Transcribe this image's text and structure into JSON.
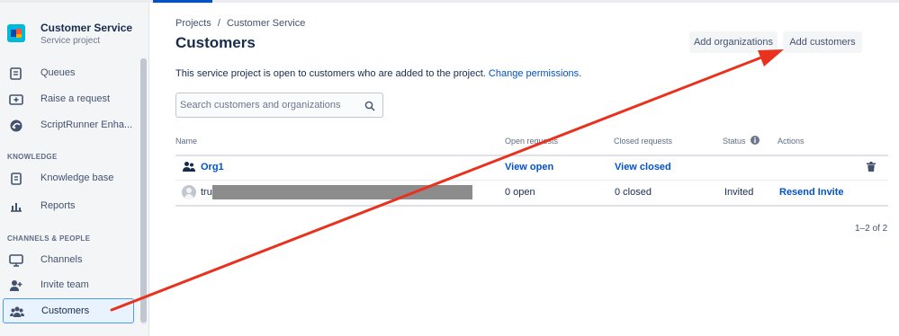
{
  "project": {
    "name": "Customer Service",
    "type": "Service project"
  },
  "sidebar": {
    "items": [
      {
        "label": "Queues"
      },
      {
        "label": "Raise a request"
      },
      {
        "label": "ScriptRunner Enha..."
      },
      {
        "label": "Knowledge base"
      },
      {
        "label": "Reports"
      },
      {
        "label": "Channels"
      },
      {
        "label": "Invite team"
      },
      {
        "label": "Customers"
      }
    ],
    "sections": {
      "knowledge": "KNOWLEDGE",
      "channels": "CHANNELS & PEOPLE"
    }
  },
  "breadcrumb": {
    "root": "Projects",
    "sep": "/",
    "current": "Customer Service"
  },
  "page": {
    "title": "Customers"
  },
  "toolbar": {
    "add_orgs": "Add organizations",
    "add_customers": "Add customers"
  },
  "info": {
    "text": "This service project is open to customers who are added to the project.",
    "link": "Change permissions",
    "period": "."
  },
  "search": {
    "placeholder": "Search customers and organizations"
  },
  "table": {
    "headers": {
      "name": "Name",
      "open": "Open requests",
      "closed": "Closed requests",
      "status": "Status",
      "actions": "Actions"
    },
    "rows": [
      {
        "name": "Org1",
        "open": "View open",
        "closed": "View closed",
        "status": "",
        "action": ""
      },
      {
        "name": "tru",
        "open": "0 open",
        "closed": "0 closed",
        "status": "Invited",
        "action": "Resend Invite"
      }
    ]
  },
  "pagination": {
    "text": "1–2 of 2"
  },
  "colors": {
    "accent": "#0052cc",
    "annotation": "#e8321e"
  }
}
